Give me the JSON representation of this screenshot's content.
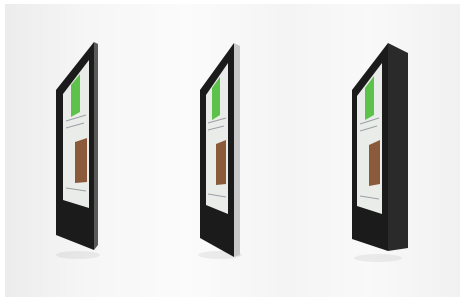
{
  "scene": {
    "background_color": "#f5f5f5",
    "panel_count": 3,
    "panels": [
      {
        "variant": "flush-mount",
        "bezel_color": "#1c1c1c",
        "edge_color": "#3a3a3a"
      },
      {
        "variant": "slim-frame",
        "bezel_color": "#1c1c1c",
        "edge_color": "#c9c9c9"
      },
      {
        "variant": "deep-box",
        "bezel_color": "#1c1c1c",
        "edge_color": "#2a2a2a"
      }
    ],
    "screen_colors": {
      "ui_background": "#e9ece8",
      "accent_green": "#5dc24a",
      "photo_tone": "#8a5a3a",
      "text_lines": "#9aa0a6"
    }
  }
}
